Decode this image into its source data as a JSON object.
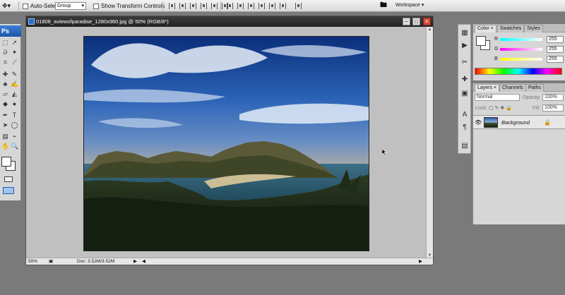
{
  "options_bar": {
    "auto_select_label": "Auto-Select:",
    "auto_select_value": "Group",
    "transform_label": "Show Transform Controls",
    "workspace_label": "Workspace ▾"
  },
  "tools": {
    "logo": "Ps"
  },
  "document": {
    "title": "01808_aviewofparadise_1280x960.jpg @ 50% (RGB/8*)",
    "zoom": "50%",
    "doc_size": "Doc: 3.52M/3.52M"
  },
  "color_panel": {
    "tabs": [
      "Color ×",
      "Swatches",
      "Styles"
    ],
    "r_label": "R",
    "g_label": "G",
    "b_label": "B",
    "r_value": "255",
    "g_value": "255",
    "b_value": "255"
  },
  "layers_panel": {
    "tabs": [
      "Layers ×",
      "Channels",
      "Paths"
    ],
    "blend_mode": "Normal",
    "opacity_label": "Opacity:",
    "opacity_value": "100%",
    "lock_label": "Lock:",
    "fill_label": "Fill:",
    "fill_value": "100%",
    "layer_name": "Background"
  },
  "colors": {
    "titlebar": "#2a2a2a",
    "close_button": "#d64a3b",
    "workspace_bg": "#7a7a7a"
  }
}
